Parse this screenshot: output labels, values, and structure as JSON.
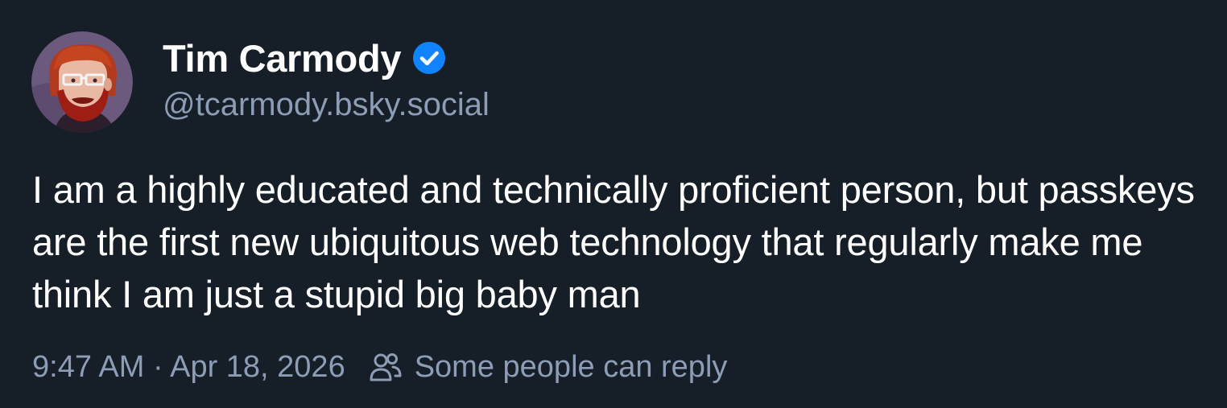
{
  "author": {
    "display_name": "Tim Carmody",
    "handle": "@tcarmody.bsky.social",
    "verified": true,
    "avatar_icon": "avatar-illustration"
  },
  "post": {
    "text": "I am a highly educated and technically proficient person, but passkeys are the first new ubiquitous web technology that regularly make me think I am just a stupid big baby man",
    "timestamp": "9:47 AM · Apr 18, 2026",
    "reply_setting": "Some people can reply",
    "reply_icon": "people-icon"
  },
  "colors": {
    "background": "#161e27",
    "text_primary": "#ffffff",
    "text_secondary": "#8c9db5",
    "verified_badge": "#1083fe"
  }
}
